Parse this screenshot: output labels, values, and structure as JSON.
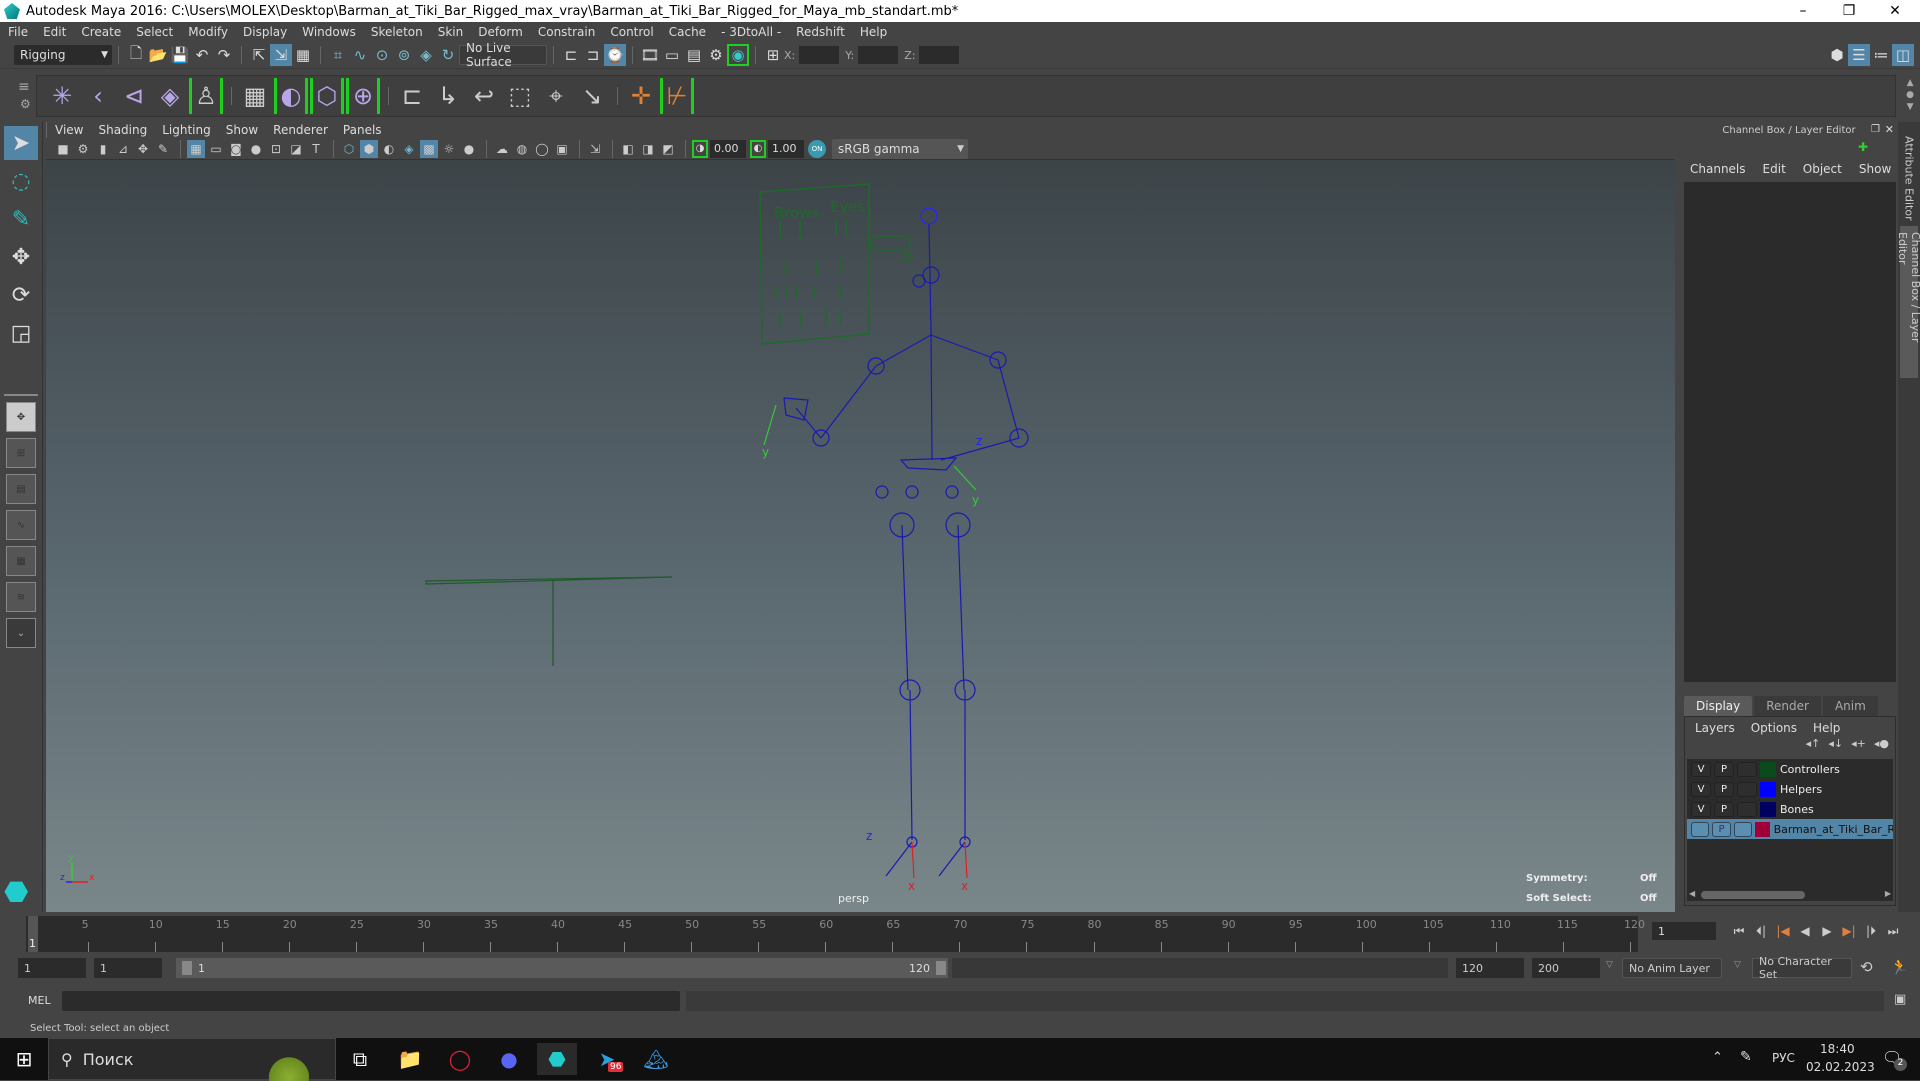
{
  "titlebar": {
    "title": "Autodesk Maya 2016: C:\\Users\\MOLEX\\Desktop\\Barman_at_Tiki_Bar_Rigged_max_vray\\Barman_at_Tiki_Bar_Rigged_for_Maya_mb_standart.mb*",
    "minimize": "–",
    "restore": "❐",
    "close": "✕"
  },
  "menubar": [
    "File",
    "Edit",
    "Create",
    "Select",
    "Modify",
    "Display",
    "Windows",
    "Skeleton",
    "Skin",
    "Deform",
    "Constrain",
    "Control",
    "Cache",
    "- 3DtoAll -",
    "Redshift",
    "Help"
  ],
  "toolbar": {
    "menuset": "Rigging",
    "live_surface": "No Live Surface",
    "x_label": "X:",
    "y_label": "Y:",
    "z_label": "Z:"
  },
  "viewport": {
    "menu": [
      "View",
      "Shading",
      "Lighting",
      "Show",
      "Renderer",
      "Panels"
    ],
    "exposure": "0.00",
    "gamma": "1.00",
    "colorspace": "sRGB gamma",
    "camera": "persp",
    "symmetry_label": "Symmetry:",
    "symmetry_value": "Off",
    "softselect_label": "Soft Select:",
    "softselect_value": "Off",
    "panel_labels": {
      "brows": "Brows",
      "eyes": "Eyes"
    }
  },
  "channelbox": {
    "title": "Channel Box / Layer Editor",
    "menu": [
      "Channels",
      "Edit",
      "Object",
      "Show"
    ],
    "tabs": [
      "Display",
      "Render",
      "Anim"
    ],
    "active_tab": "Display",
    "layer_menu": [
      "Layers",
      "Options",
      "Help"
    ],
    "layers": [
      {
        "v": "V",
        "p": "P",
        "name": "Controllers",
        "color": "#0a4a1c",
        "selected": false
      },
      {
        "v": "V",
        "p": "P",
        "name": "Helpers",
        "color": "#0000ff",
        "selected": false
      },
      {
        "v": "V",
        "p": "P",
        "name": "Bones",
        "color": "#000060",
        "selected": false
      },
      {
        "v": "",
        "p": "P",
        "name": "Barman_at_Tiki_Bar_Rig",
        "color": "#a0003a",
        "selected": true
      }
    ],
    "side_tabs": [
      "Attribute Editor",
      "Channel Box / Layer Editor"
    ]
  },
  "timeline": {
    "start_label": "1",
    "ticks": [
      5,
      10,
      15,
      20,
      25,
      30,
      35,
      40,
      45,
      50,
      55,
      60,
      65,
      70,
      75,
      80,
      85,
      90,
      95,
      100,
      105,
      110,
      115,
      120
    ],
    "current_frame": "1",
    "min": 1,
    "max": 120
  },
  "range": {
    "start": "1",
    "anim_start": "1",
    "slider_start": "1",
    "slider_end": "120",
    "end": "120",
    "anim_end": "200",
    "anim_layer": "No Anim Layer",
    "character_set": "No Character Set"
  },
  "cmdline": {
    "label": "MEL",
    "value": ""
  },
  "helpline": "Select Tool: select an object",
  "taskbar": {
    "search_placeholder": "Поиск",
    "telegram_badge": "96",
    "lang": "РУС",
    "time": "18:40",
    "date": "02.02.2023",
    "notifications": "2"
  },
  "colors": {
    "accent": "#5285a6",
    "highlight_green": "#1ed01e",
    "rig_blue": "#1a1ab0",
    "controller_green": "#1e5a2a"
  }
}
